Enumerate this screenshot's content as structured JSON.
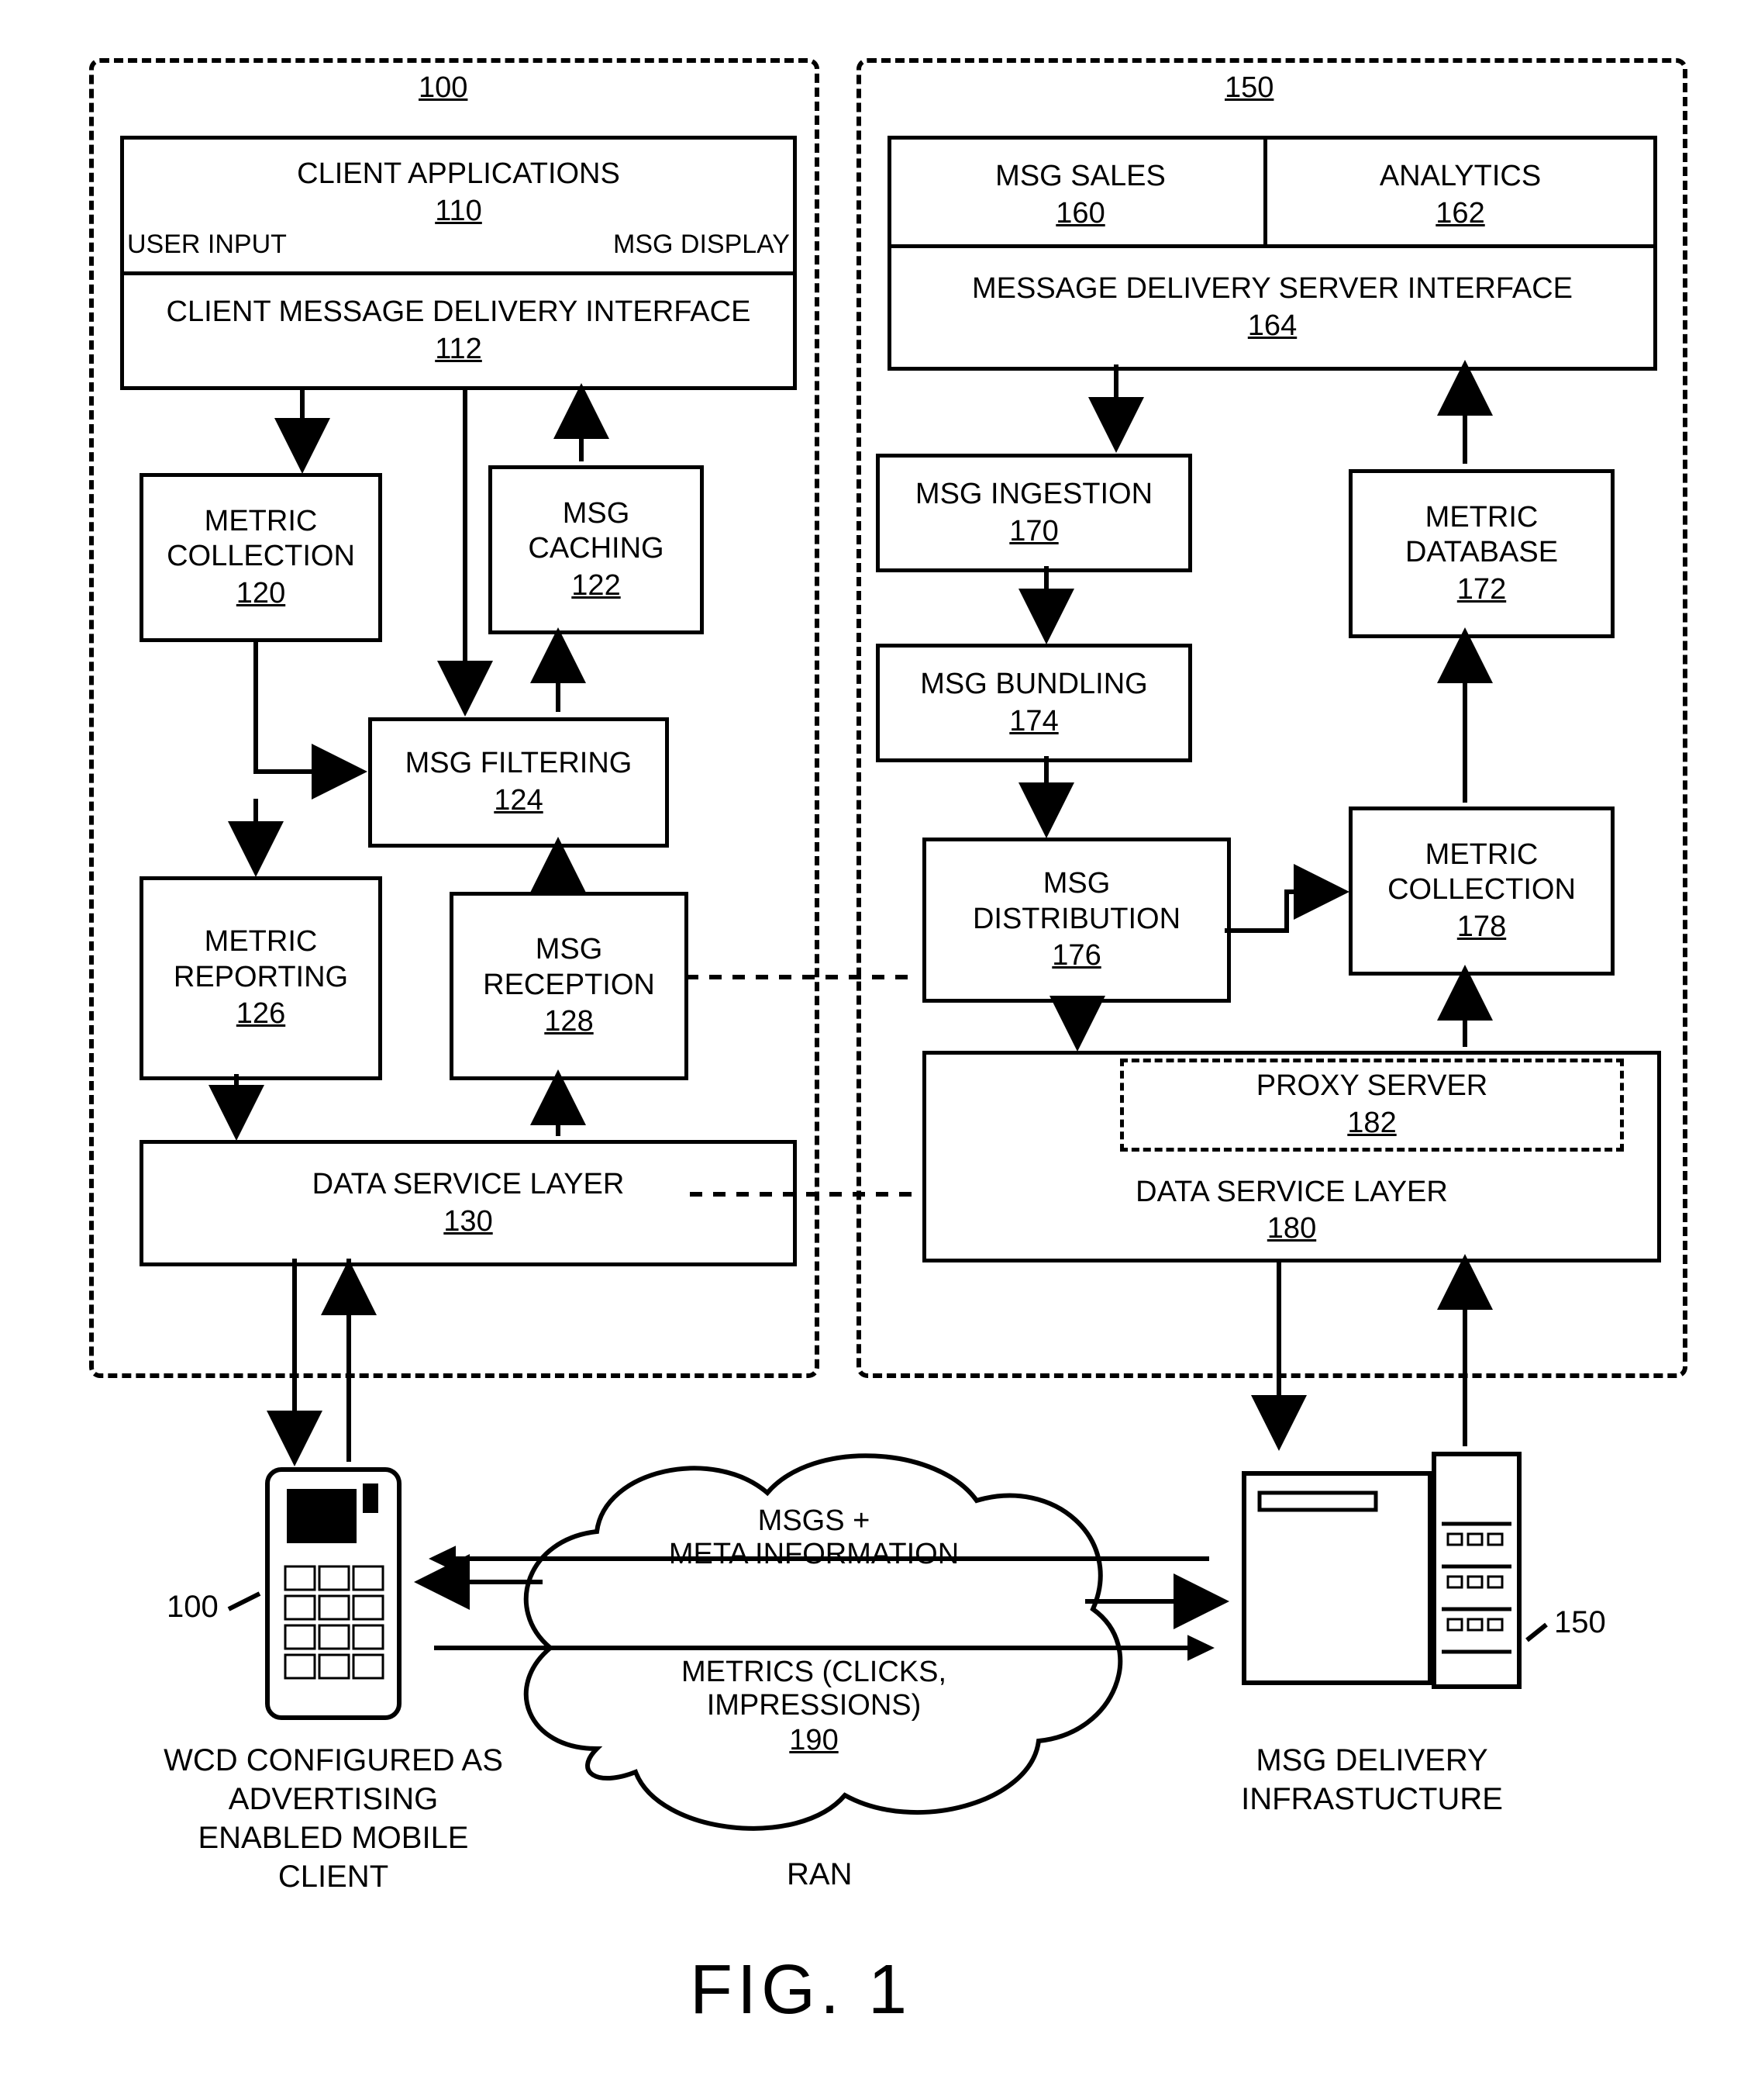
{
  "left": {
    "containerNum": "100",
    "clientApps": {
      "title": "CLIENT APPLICATIONS",
      "num": "110",
      "left": "USER INPUT",
      "right": "MSG DISPLAY"
    },
    "cmdi": {
      "title": "CLIENT MESSAGE DELIVERY INTERFACE",
      "num": "112"
    },
    "metricCollection": {
      "title": "METRIC COLLECTION",
      "num": "120"
    },
    "msgCaching": {
      "title": "MSG CACHING",
      "num": "122"
    },
    "msgFiltering": {
      "title": "MSG FILTERING",
      "num": "124"
    },
    "metricReporting": {
      "title": "METRIC REPORTING",
      "num": "126"
    },
    "msgReception": {
      "title": "MSG RECEPTION",
      "num": "128"
    },
    "dataService": {
      "title": "DATA SERVICE LAYER",
      "num": "130"
    }
  },
  "right": {
    "containerNum": "150",
    "msgSales": {
      "title": "MSG SALES",
      "num": "160"
    },
    "analytics": {
      "title": "ANALYTICS",
      "num": "162"
    },
    "mdsi": {
      "title": "MESSAGE DELIVERY SERVER INTERFACE",
      "num": "164"
    },
    "msgIngestion": {
      "title": "MSG INGESTION",
      "num": "170"
    },
    "metricDatabase": {
      "title": "METRIC DATABASE",
      "num": "172"
    },
    "msgBundling": {
      "title": "MSG BUNDLING",
      "num": "174"
    },
    "msgDistribution": {
      "title": "MSG DISTRIBUTION",
      "num": "176"
    },
    "metricCollection": {
      "title": "METRIC COLLECTION",
      "num": "178"
    },
    "proxy": {
      "title": "PROXY SERVER",
      "num": "182"
    },
    "dataService": {
      "title": "DATA SERVICE LAYER",
      "num": "180"
    }
  },
  "bottom": {
    "cloudLine1": "MSGS +",
    "cloudLine2": "META INFORMATION",
    "cloudLine3": "METRICS (CLICKS,",
    "cloudLine4": "IMPRESSIONS)",
    "cloudNum": "190",
    "ran": "RAN",
    "wcdNum": "100",
    "wcdLabel": "WCD CONFIGURED AS ADVERTISING ENABLED MOBILE CLIENT",
    "serverNum": "150",
    "serverLabel": "MSG DELIVERY INFRASTUCTURE"
  },
  "figTitle": "FIG. 1"
}
